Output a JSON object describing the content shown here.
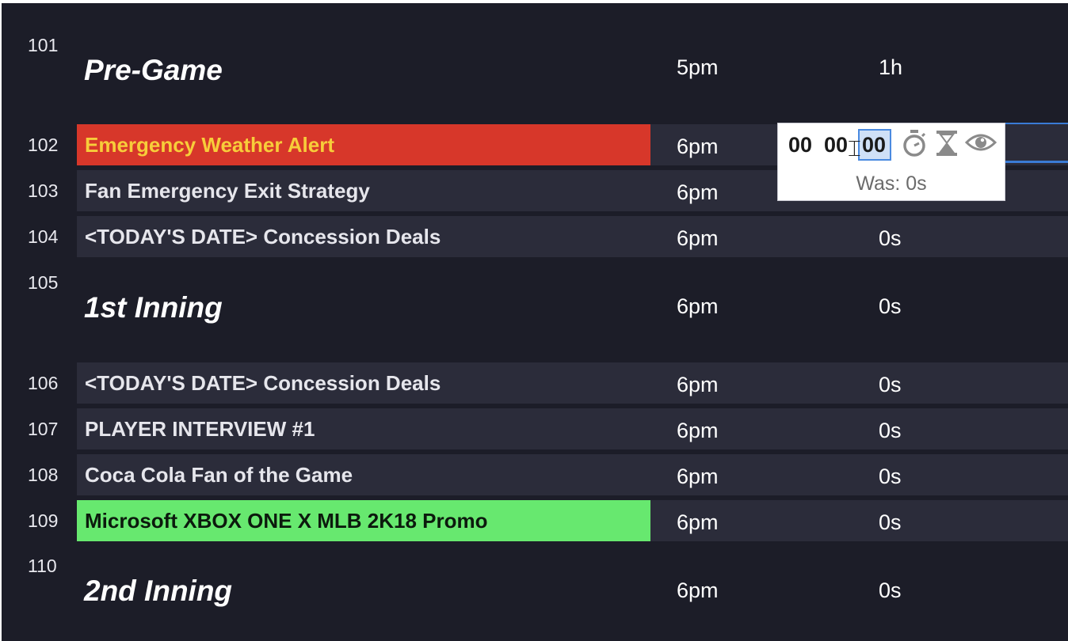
{
  "rows": [
    {
      "num": "101",
      "title": "Pre-Game",
      "time": "5pm",
      "duration": "1h",
      "kind": "header"
    },
    {
      "num": "102",
      "title": "Emergency Weather Alert",
      "time": "6pm",
      "duration": "",
      "kind": "red"
    },
    {
      "num": "103",
      "title": "Fan Emergency Exit Strategy",
      "time": "6pm",
      "duration": "",
      "kind": "normal"
    },
    {
      "num": "104",
      "title": "<TODAY'S DATE> Concession Deals",
      "time": "6pm",
      "duration": "0s",
      "kind": "normal"
    },
    {
      "num": "105",
      "title": "1st Inning",
      "time": "6pm",
      "duration": "0s",
      "kind": "header"
    },
    {
      "num": "106",
      "title": "<TODAY'S DATE> Concession Deals",
      "time": "6pm",
      "duration": "0s",
      "kind": "normal"
    },
    {
      "num": "107",
      "title": "PLAYER INTERVIEW #1",
      "time": "6pm",
      "duration": "0s",
      "kind": "normal"
    },
    {
      "num": "108",
      "title": "Coca Cola Fan of the Game",
      "time": "6pm",
      "duration": "0s",
      "kind": "normal"
    },
    {
      "num": "109",
      "title": "Microsoft XBOX ONE X MLB 2K18 Promo",
      "time": "6pm",
      "duration": "0s",
      "kind": "green"
    },
    {
      "num": "110",
      "title": "2nd Inning",
      "time": "6pm",
      "duration": "0s",
      "kind": "header"
    }
  ],
  "editor": {
    "hours": "00",
    "minutes": "00",
    "seconds": "00",
    "was_label": "Was: 0s",
    "icons": [
      "stopwatch-icon",
      "hourglass-icon",
      "eye-icon"
    ]
  },
  "colors": {
    "background": "#1c1d28",
    "row": "#2b2c3a",
    "alert_red": "#d7372a",
    "alert_text": "#f7cd3a",
    "promo_green": "#67e86f",
    "accent_blue": "#3a7bd5"
  }
}
